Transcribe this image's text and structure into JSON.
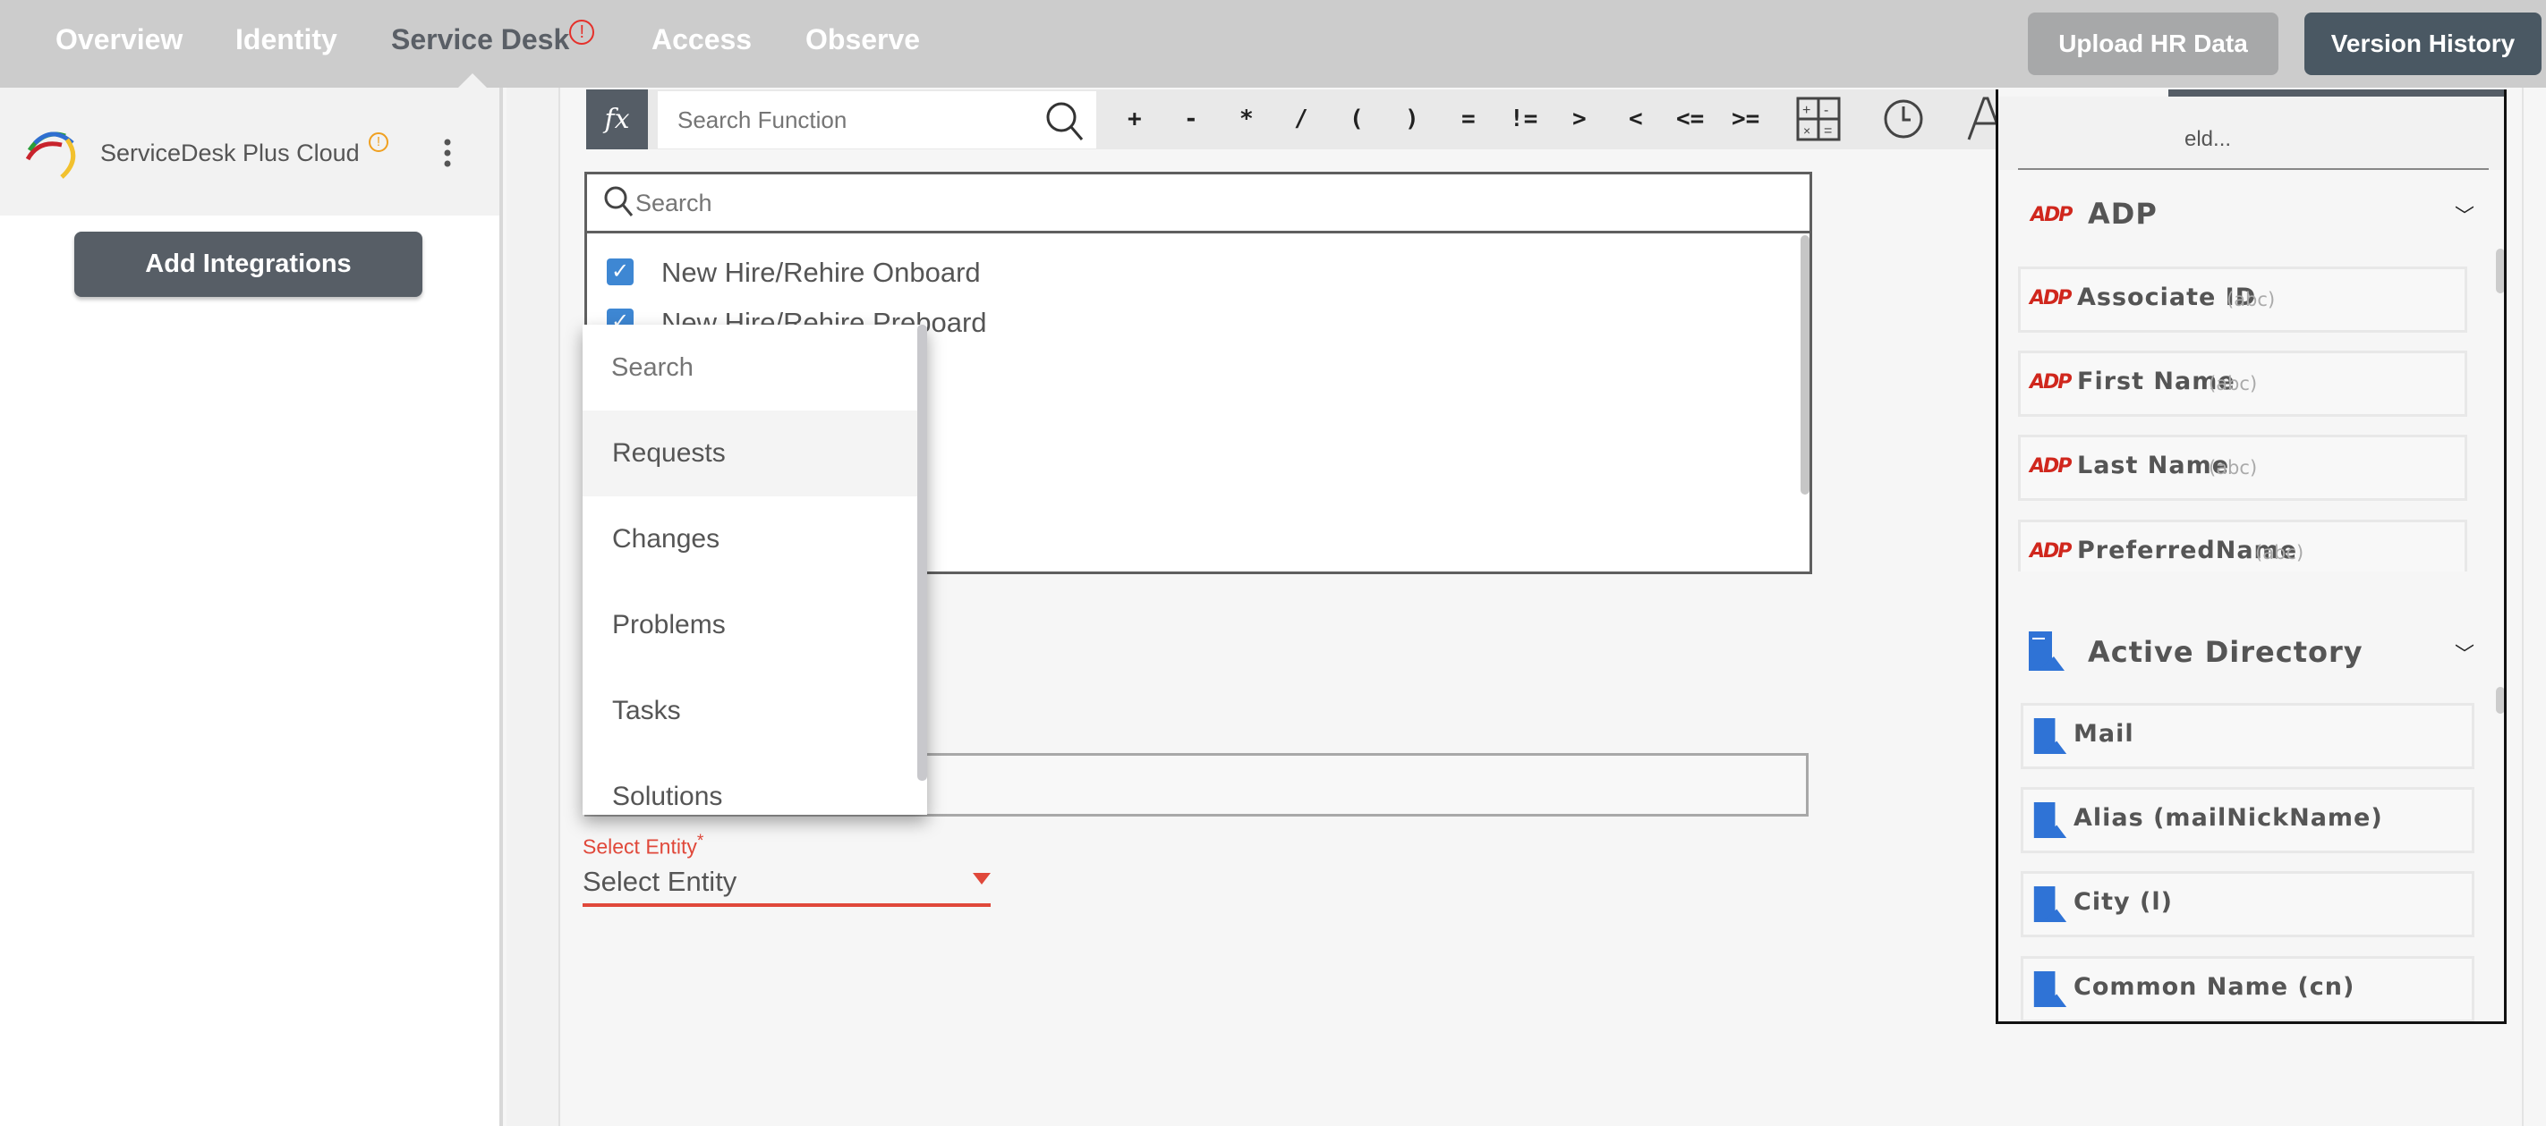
{
  "nav": {
    "tabs": [
      {
        "label": "Overview"
      },
      {
        "label": "Identity"
      },
      {
        "label": "Service Desk",
        "active": true,
        "alert": true
      },
      {
        "label": "Access"
      },
      {
        "label": "Observe"
      }
    ],
    "alert_glyph": "!",
    "upload_label": "Upload HR Data",
    "version_label": "Version History"
  },
  "sidebar": {
    "integration_name": "ServiceDesk Plus Cloud",
    "warning_glyph": "!",
    "add_label": "Add Integrations"
  },
  "toolbar": {
    "fx_label": "fx",
    "search_placeholder": "Search Function",
    "operators": [
      "+",
      "-",
      "*",
      "/",
      "(",
      ")",
      "=",
      "!=",
      ">",
      "<",
      "<=",
      ">="
    ],
    "icons": [
      "calculator-icon",
      "clock-icon",
      "text-icon",
      "info-icon",
      "ai-brain-icon"
    ]
  },
  "checklist": {
    "search_placeholder": "Search",
    "items": [
      {
        "label": "New Hire/Rehire Onboard",
        "checked": true
      },
      {
        "label": "New Hire/Rehire Preboard",
        "checked": true
      }
    ]
  },
  "dropdown": {
    "search_placeholder": "Search",
    "options": [
      "Requests",
      "Changes",
      "Problems",
      "Tasks",
      "Solutions"
    ],
    "highlighted": "Requests"
  },
  "entity": {
    "label": "Select Entity",
    "required_mark": "*",
    "value": "Select Entity",
    "accent": "#e0483a"
  },
  "fields_panel": {
    "search_partial": "eld...",
    "groups": [
      {
        "name": "ADP",
        "logo": "ADP",
        "fields": [
          {
            "label": "Associate ID",
            "type": "(abc)"
          },
          {
            "label": "First Name",
            "type": "(abc)"
          },
          {
            "label": "Last Name",
            "type": "(abc)"
          },
          {
            "label": "PreferredName",
            "type": "(abc)"
          }
        ]
      },
      {
        "name": "Active Directory",
        "fields": [
          {
            "label": "Mail"
          },
          {
            "label": "Alias (mailNickName)"
          },
          {
            "label": "City (l)"
          },
          {
            "label": "Common Name (cn)"
          }
        ]
      }
    ]
  },
  "colors": {
    "topbar": "#cccccc",
    "dark_button": "#4a5863",
    "checkbox": "#3e87d3",
    "adp_red": "#d0271d",
    "ad_blue": "#2f73d6"
  }
}
